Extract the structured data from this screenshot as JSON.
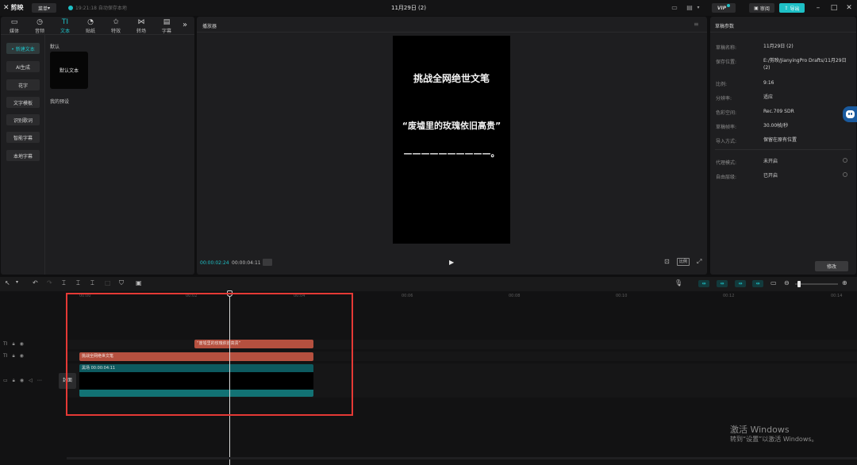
{
  "topbar": {
    "logo_text": "剪映",
    "menu_label": "菜单",
    "save_status": "19:21:18 自动保存本地",
    "doc_title": "11月29日 (2)",
    "vip_label": "VIP",
    "review_label": "审阅",
    "export_label": "导出",
    "accent_color": "#1ec0c6"
  },
  "tabs": [
    {
      "label": "媒体",
      "icon": "media-icon"
    },
    {
      "label": "音频",
      "icon": "audio-icon"
    },
    {
      "label": "文本",
      "icon": "text-icon",
      "active": true
    },
    {
      "label": "贴纸",
      "icon": "sticker-icon"
    },
    {
      "label": "特效",
      "icon": "effects-icon"
    },
    {
      "label": "转场",
      "icon": "transition-icon"
    },
    {
      "label": "字幕",
      "icon": "subtitle-icon"
    }
  ],
  "side_menu": [
    {
      "label": "• 新建文本",
      "active": true
    },
    {
      "label": "AI生成"
    },
    {
      "label": "花字"
    },
    {
      "label": "文字模板"
    },
    {
      "label": "识别歌词"
    },
    {
      "label": "智能字幕"
    },
    {
      "label": "本地字幕"
    }
  ],
  "text_panel": {
    "section_default": "默认",
    "preset_card": "默认文本",
    "section_mine": "我的预设"
  },
  "player": {
    "title": "播放器",
    "canvas_lines": [
      "挑战全网绝世文笔",
      "“废墟里的玫瑰依旧高贵”",
      "——————————。"
    ],
    "time_current": "00:00:02:24",
    "time_total": "00:00:04:11",
    "ratio_label": "比例"
  },
  "draft_params": {
    "title": "草稿参数",
    "rows": [
      {
        "key": "草稿名称:",
        "value": "11月29日 (2)"
      },
      {
        "key": "保存位置:",
        "value": "E:/剪映/JianyingPro Drafts/11月29日 (2)"
      },
      {
        "key": "比例:",
        "value": "9:16"
      },
      {
        "key": "分辨率:",
        "value": "适应"
      },
      {
        "key": "色彩空间:",
        "value": "Rec.709 SDR"
      },
      {
        "key": "草稿帧率:",
        "value": "30.00帧/秒"
      },
      {
        "key": "导入方式:",
        "value": "保留在原有位置"
      }
    ],
    "rows2": [
      {
        "key": "代理模式:",
        "value": "未开启"
      },
      {
        "key": "自由层级:",
        "value": "已开启"
      }
    ],
    "modify_label": "修改"
  },
  "timeline": {
    "ticks": [
      "00:00",
      "00:02",
      "00:04",
      "00:06",
      "00:08",
      "00:10",
      "00:12",
      "00:14"
    ],
    "clip_quote": "“废墟里的玫瑰依旧高贵”",
    "clip_title": "挑战全网绝世文笔",
    "video_label": "黑场  00:00:04:11",
    "cover_label": "封面"
  },
  "watermark": {
    "line1": "激活 Windows",
    "line2": "转到“设置”以激活 Windows。"
  }
}
